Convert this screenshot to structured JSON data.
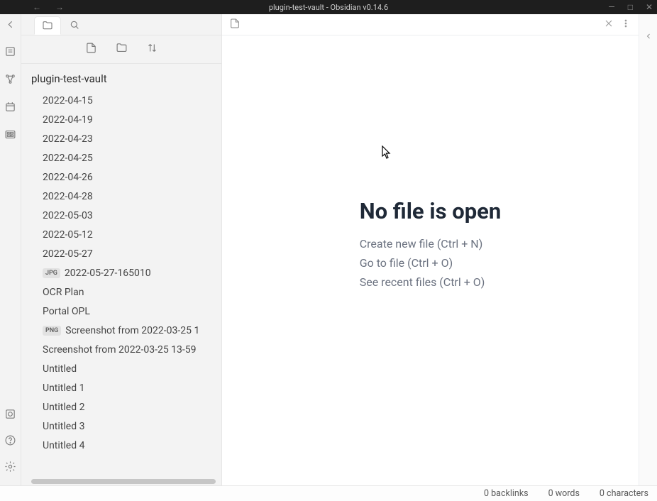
{
  "titlebar": {
    "title": "plugin-test-vault - Obsidian v0.14.6"
  },
  "sidebar": {
    "vault_name": "plugin-test-vault",
    "files": [
      {
        "name": "2022-04-15",
        "badge": null
      },
      {
        "name": "2022-04-19",
        "badge": null
      },
      {
        "name": "2022-04-23",
        "badge": null
      },
      {
        "name": "2022-04-25",
        "badge": null
      },
      {
        "name": "2022-04-26",
        "badge": null
      },
      {
        "name": "2022-04-28",
        "badge": null
      },
      {
        "name": "2022-05-03",
        "badge": null
      },
      {
        "name": "2022-05-12",
        "badge": null
      },
      {
        "name": "2022-05-27",
        "badge": null
      },
      {
        "name": "2022-05-27-165010",
        "badge": "JPG"
      },
      {
        "name": "OCR Plan",
        "badge": null
      },
      {
        "name": "Portal OPL",
        "badge": null
      },
      {
        "name": "Screenshot from 2022-03-25 1",
        "badge": "PNG"
      },
      {
        "name": "Screenshot from 2022-03-25 13-59",
        "badge": null
      },
      {
        "name": "Untitled",
        "badge": null
      },
      {
        "name": "Untitled 1",
        "badge": null
      },
      {
        "name": "Untitled 2",
        "badge": null
      },
      {
        "name": "Untitled 3",
        "badge": null
      },
      {
        "name": "Untitled 4",
        "badge": null
      }
    ]
  },
  "empty": {
    "heading": "No file is open",
    "create": "Create new file (Ctrl + N)",
    "goto": "Go to file (Ctrl + O)",
    "recent": "See recent files (Ctrl + O)"
  },
  "status": {
    "backlinks": "0 backlinks",
    "words": "0 words",
    "chars": "0 characters"
  }
}
